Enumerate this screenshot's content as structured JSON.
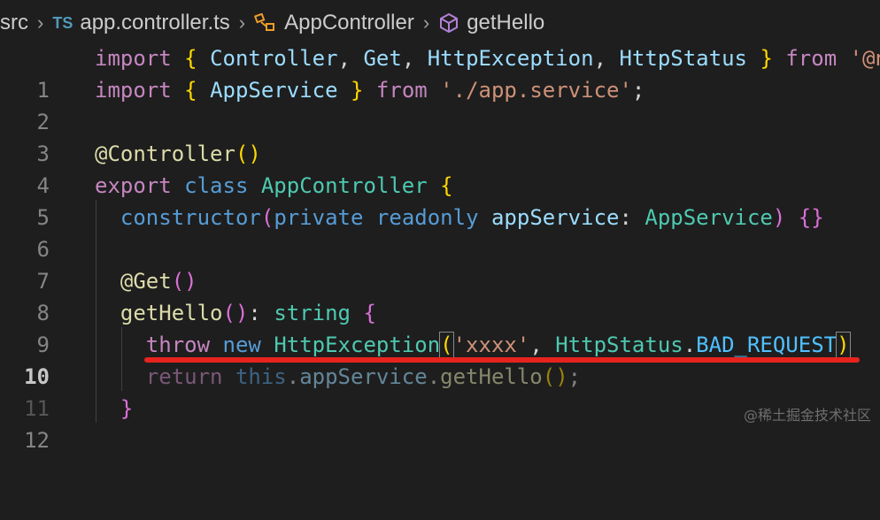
{
  "breadcrumb": {
    "folder": "src",
    "file_badge": "TS",
    "file": "app.controller.ts",
    "class": "AppController",
    "method": "getHello"
  },
  "lines": [
    {
      "n": "1"
    },
    {
      "n": "2"
    },
    {
      "n": "3"
    },
    {
      "n": "4"
    },
    {
      "n": "5"
    },
    {
      "n": "6"
    },
    {
      "n": "7"
    },
    {
      "n": "8"
    },
    {
      "n": "9"
    },
    {
      "n": "10"
    },
    {
      "n": "11"
    },
    {
      "n": "12"
    }
  ],
  "code": {
    "l1": {
      "import": "import",
      "ob": "{",
      "controller": "Controller",
      "c1": ",",
      "get": "Get",
      "c2": ",",
      "httpexc": "HttpException",
      "c3": ",",
      "httpstatus": "HttpStatus",
      "cb": "}",
      "from": "from",
      "src": "'@n"
    },
    "l2": {
      "import": "import",
      "ob": "{",
      "appservice": "AppService",
      "cb": "}",
      "from": "from",
      "src": "'./app.service'",
      "semi": ";"
    },
    "l4": {
      "at": "@Controller",
      "paren": "()"
    },
    "l5": {
      "export": "export",
      "class": "class",
      "name": "AppController",
      "ob": "{"
    },
    "l6": {
      "ctor": "constructor",
      "op": "(",
      "private": "private",
      "readonly": "readonly",
      "param": "appService",
      "colon": ":",
      "type": "AppService",
      "cp": ")",
      "braces": "{}"
    },
    "l8": {
      "at": "@Get",
      "paren": "()"
    },
    "l9": {
      "name": "getHello",
      "paren": "()",
      "colon": ":",
      "type": "string",
      "ob": "{"
    },
    "l10": {
      "throw": "throw",
      "new": "new",
      "cls": "HttpException",
      "op": "(",
      "str": "'xxxx'",
      "comma": ",",
      "status": "HttpStatus",
      "dot": ".",
      "member": "BAD_REQUEST",
      "cp": ")"
    },
    "l11": {
      "return": "return",
      "this": "this",
      "dot1": ".",
      "prop": "appService",
      "dot2": ".",
      "method": "getHello",
      "paren": "()",
      "semi": ";"
    },
    "l12": {
      "cb": "}"
    }
  },
  "watermark": "@稀土掘金技术社区",
  "colors": {
    "background": "#1e1e1e",
    "keyword": "#569cd6",
    "control": "#c586c0",
    "type": "#4ec9b0",
    "string": "#ce9178",
    "annotation_underline": "#e8231e"
  }
}
